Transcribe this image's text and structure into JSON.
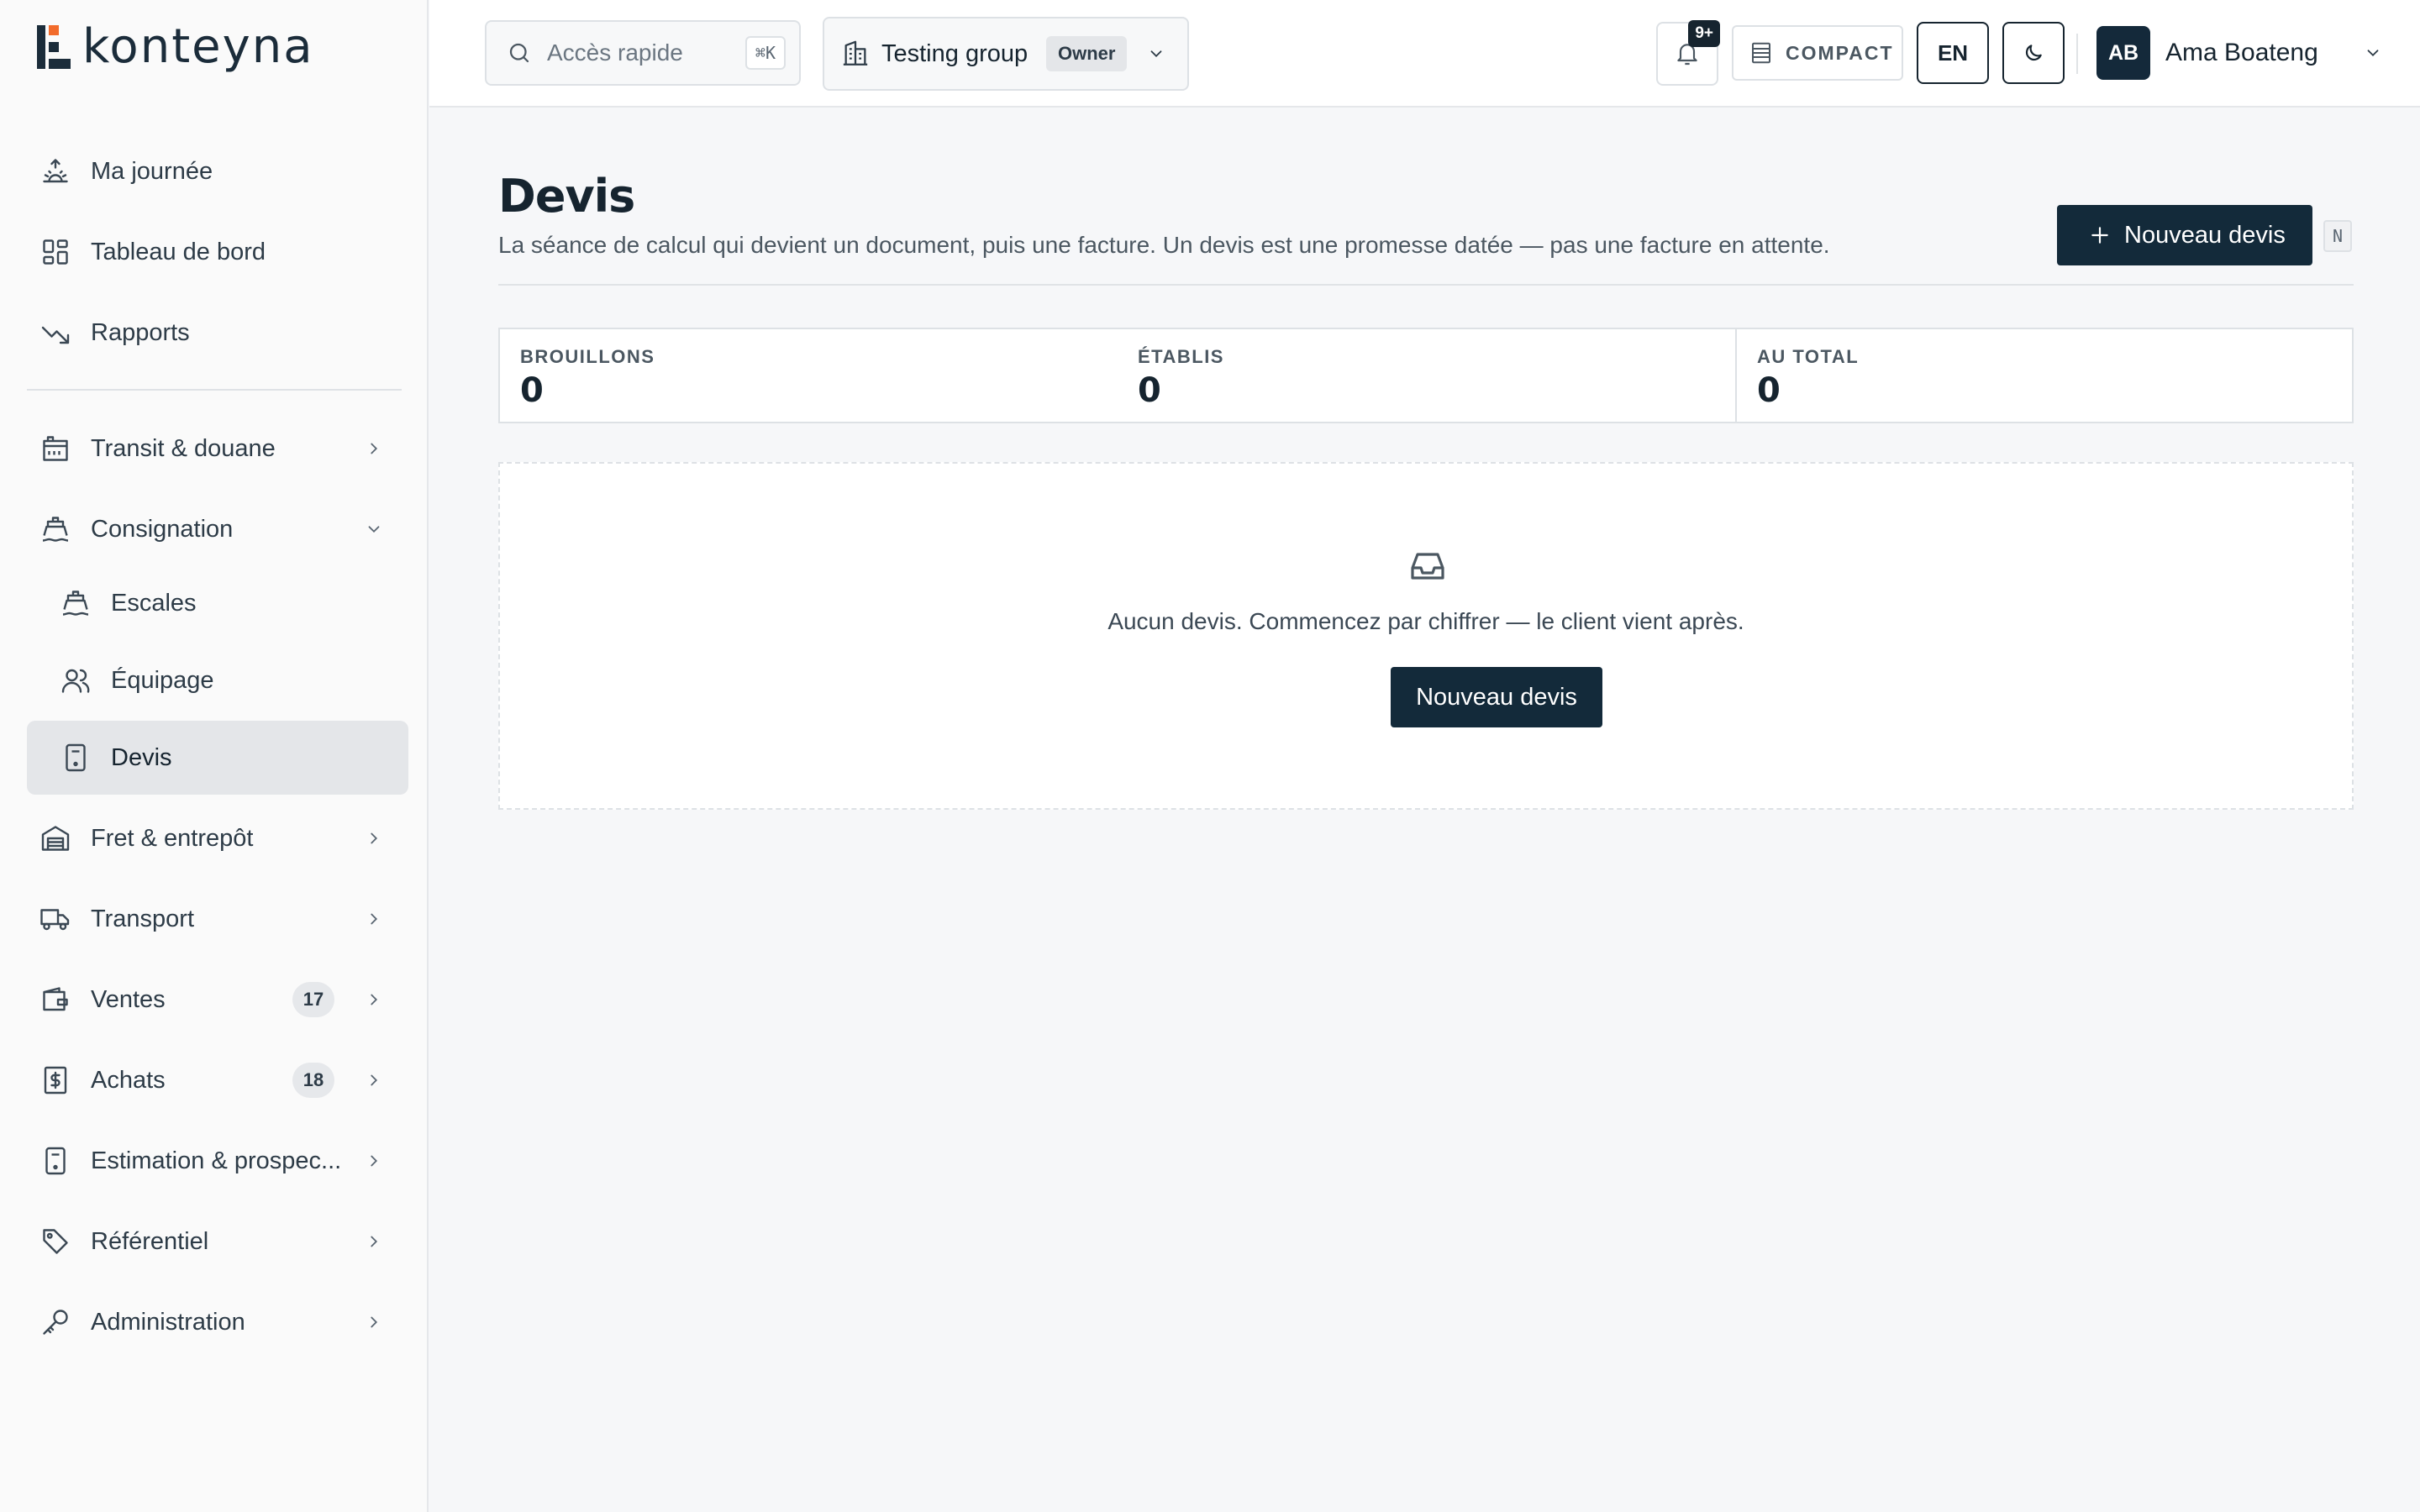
{
  "brand": {
    "name": "konteyna"
  },
  "sidebar": {
    "top_items": [
      {
        "label": "Ma journée",
        "icon": "sunrise-icon"
      },
      {
        "label": "Tableau de bord",
        "icon": "dashboard-grid-icon"
      },
      {
        "label": "Rapports",
        "icon": "trend-down-icon"
      }
    ],
    "sections": [
      {
        "label": "Transit & douane",
        "icon": "customs-building-icon",
        "expanded": false
      },
      {
        "label": "Consignation",
        "icon": "ship-icon",
        "expanded": true,
        "children": [
          {
            "label": "Escales",
            "icon": "ship-icon"
          },
          {
            "label": "Équipage",
            "icon": "users-icon"
          },
          {
            "label": "Devis",
            "icon": "calculator-icon",
            "active": true
          }
        ]
      },
      {
        "label": "Fret & entrepôt",
        "icon": "warehouse-icon",
        "expanded": false
      },
      {
        "label": "Transport",
        "icon": "truck-icon",
        "expanded": false
      },
      {
        "label": "Ventes",
        "icon": "wallet-icon",
        "count": "17",
        "expanded": false
      },
      {
        "label": "Achats",
        "icon": "receipt-dollar-icon",
        "count": "18",
        "expanded": false
      },
      {
        "label": "Estimation & prospec...",
        "icon": "calculator-icon",
        "expanded": false
      },
      {
        "label": "Référentiel",
        "icon": "tag-icon",
        "expanded": false
      },
      {
        "label": "Administration",
        "icon": "key-icon",
        "expanded": false
      }
    ]
  },
  "topbar": {
    "search": {
      "placeholder": "Accès rapide",
      "shortcut": "⌘K"
    },
    "org": {
      "name": "Testing group",
      "role": "Owner"
    },
    "notifications": {
      "badge": "9+"
    },
    "density": {
      "label": "COMPACT"
    },
    "language": "EN",
    "user": {
      "initials": "AB",
      "name": "Ama Boateng"
    }
  },
  "page": {
    "title": "Devis",
    "description": "La séance de calcul qui devient un document, puis une facture. Un devis est une promesse datée — pas une facture en attente.",
    "primary_action": "Nouveau devis",
    "primary_shortcut": "N",
    "stats": [
      {
        "label": "BROUILLONS",
        "value": "0"
      },
      {
        "label": "ÉTABLIS",
        "value": "0"
      },
      {
        "label": "AU TOTAL",
        "value": "0"
      }
    ],
    "empty_state": {
      "icon": "inbox-icon",
      "message": "Aucun devis. Commencez par chiffrer — le client vient après.",
      "action": "Nouveau devis"
    }
  },
  "colors": {
    "primary": "#132a3a",
    "accent": "#f26b2b",
    "page_bg": "#f6f7f9",
    "sidebar_bg": "#fafafa",
    "active_item_bg": "#e4e6e9"
  }
}
